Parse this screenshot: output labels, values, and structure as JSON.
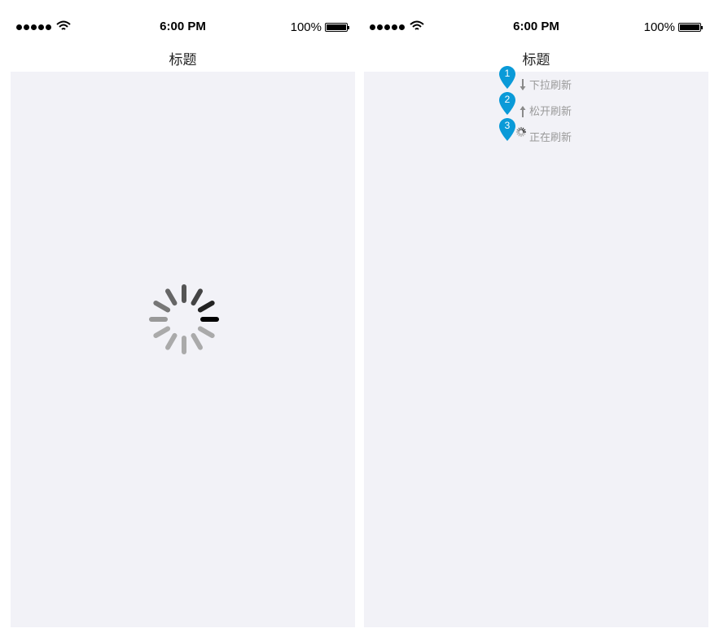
{
  "screens": [
    {
      "status_bar": {
        "time": "6:00 PM",
        "battery": "100%"
      },
      "nav": {
        "title": "标题"
      }
    },
    {
      "status_bar": {
        "time": "6:00 PM",
        "battery": "100%"
      },
      "nav": {
        "title": "标题"
      },
      "refresh_states": [
        {
          "marker": "1",
          "label": "下拉刷新",
          "icon": "arrow-down-icon"
        },
        {
          "marker": "2",
          "label": "松开刷新",
          "icon": "arrow-up-icon"
        },
        {
          "marker": "3",
          "label": "正在刷新",
          "icon": "spinner-icon"
        }
      ]
    }
  ],
  "colors": {
    "content_bg": "#f2f2f7",
    "marker": "#0a9ad8",
    "label": "#9a9a9a"
  }
}
